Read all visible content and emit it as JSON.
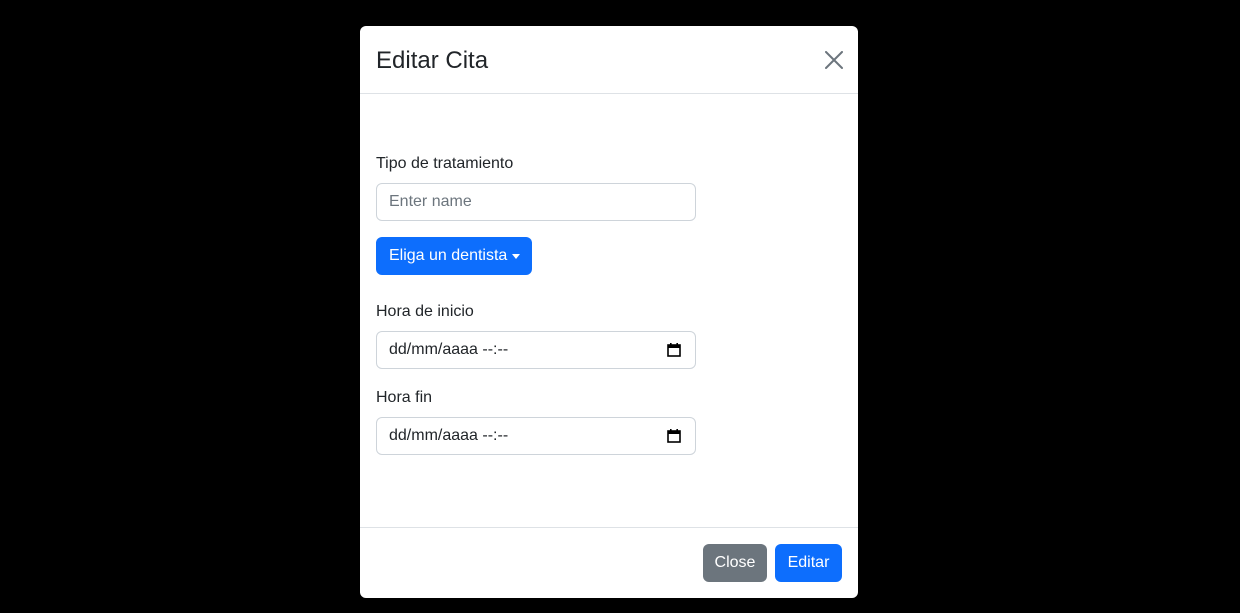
{
  "modal": {
    "title": "Editar Cita",
    "close_icon": "close-icon"
  },
  "form": {
    "treatment_label": "Tipo de tratamiento",
    "treatment_placeholder": "Enter name",
    "dentist_dropdown_label": "Eliga un dentista",
    "start_label": "Hora de inicio",
    "start_value": "dd/mm/aaaa --:--",
    "end_label": "Hora fin",
    "end_value": "dd/mm/aaaa --:--"
  },
  "footer": {
    "close_label": "Close",
    "edit_label": "Editar"
  },
  "colors": {
    "primary": "#0d6efd",
    "secondary": "#6c757d",
    "backdrop": "#000000"
  }
}
